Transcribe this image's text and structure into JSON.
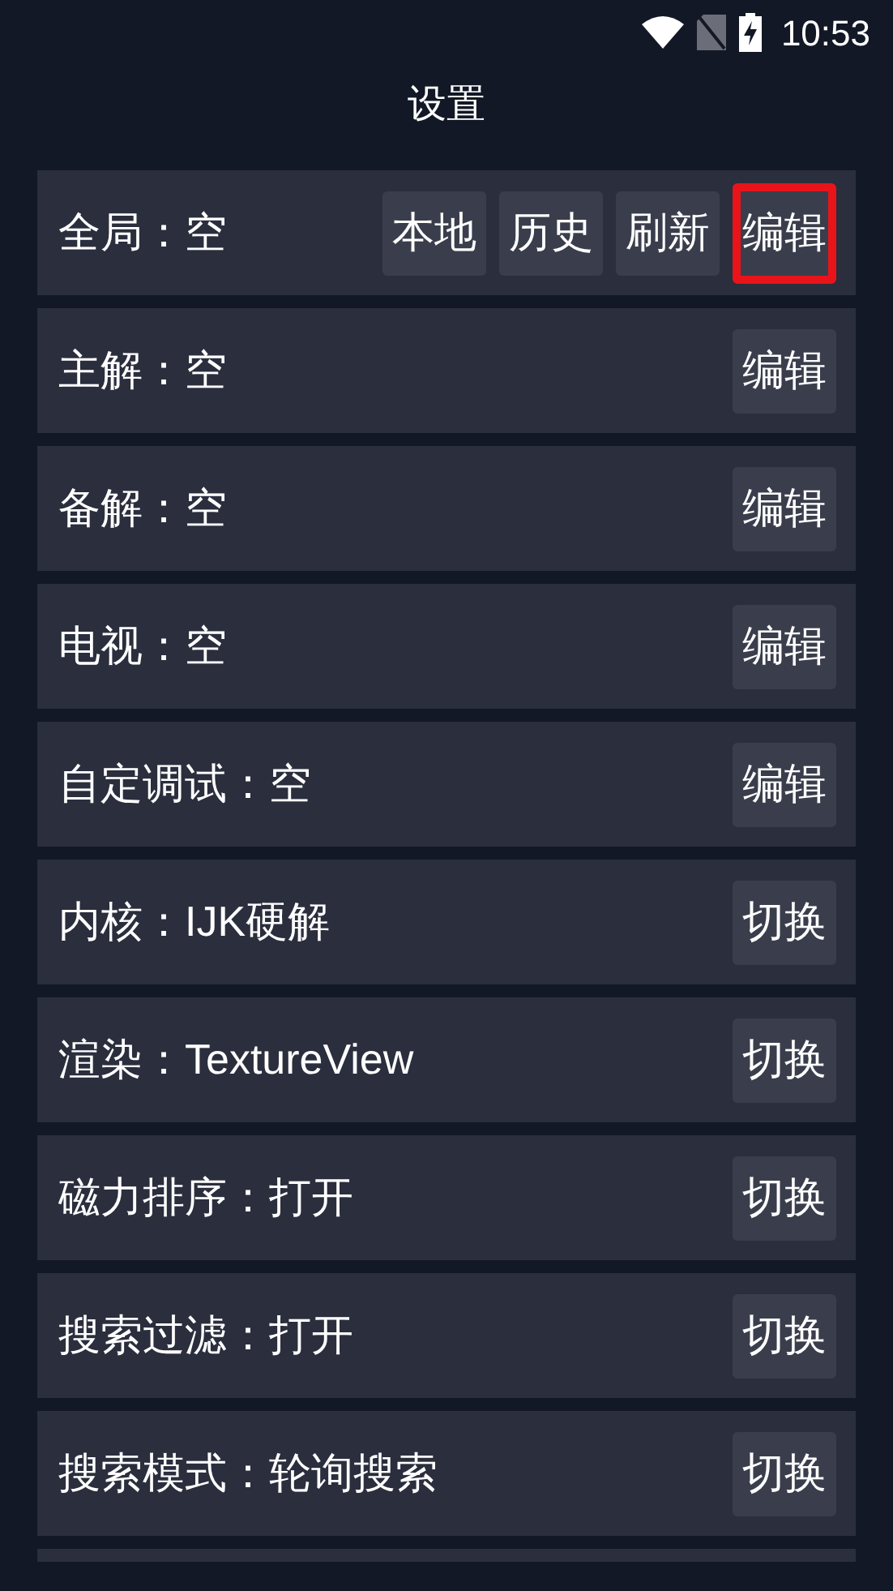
{
  "status_bar": {
    "time": "10:53"
  },
  "title": "设置",
  "rows": [
    {
      "label": "全局：空",
      "buttons": [
        {
          "label": "本地",
          "highlighted": false
        },
        {
          "label": "历史",
          "highlighted": false
        },
        {
          "label": "刷新",
          "highlighted": false
        },
        {
          "label": "编辑",
          "highlighted": true
        }
      ]
    },
    {
      "label": "主解：空",
      "buttons": [
        {
          "label": "编辑",
          "highlighted": false
        }
      ]
    },
    {
      "label": "备解：空",
      "buttons": [
        {
          "label": "编辑",
          "highlighted": false
        }
      ]
    },
    {
      "label": "电视：空",
      "buttons": [
        {
          "label": "编辑",
          "highlighted": false
        }
      ]
    },
    {
      "label": "自定调试：空",
      "buttons": [
        {
          "label": "编辑",
          "highlighted": false
        }
      ]
    },
    {
      "label": "内核：IJK硬解",
      "buttons": [
        {
          "label": "切换",
          "highlighted": false
        }
      ]
    },
    {
      "label": "渲染：TextureView",
      "buttons": [
        {
          "label": "切换",
          "highlighted": false
        }
      ]
    },
    {
      "label": "磁力排序：打开",
      "buttons": [
        {
          "label": "切换",
          "highlighted": false
        }
      ]
    },
    {
      "label": "搜索过滤：打开",
      "buttons": [
        {
          "label": "切换",
          "highlighted": false
        }
      ]
    },
    {
      "label": "搜索模式：轮询搜索",
      "buttons": [
        {
          "label": "切换",
          "highlighted": false
        }
      ]
    }
  ]
}
